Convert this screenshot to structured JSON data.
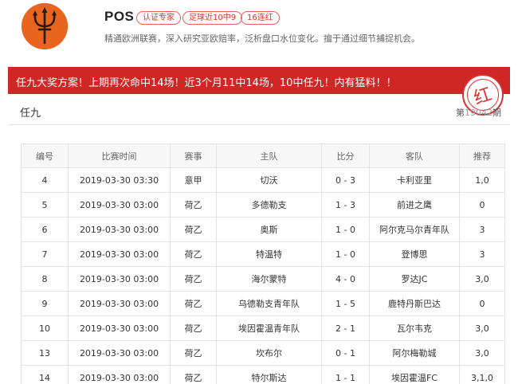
{
  "profile": {
    "avatar": "red-devil-trident-logo",
    "name": "POS",
    "badges": [
      "认证专家",
      "足球近10中9",
      "16连红"
    ],
    "bio": "精通欧洲联赛，深入研究亚欧赔率，泛析盘口水位变化。擅于通过细节捕捉机会。"
  },
  "banner": {
    "text": "任九大奖方案！上期再次命中14场！近3个月11中14场，10中任九！内有猛料！！",
    "stamp": "红",
    "color": "#cf2726"
  },
  "section": {
    "title": "任九",
    "period_prefix": "第",
    "period_number": "19042",
    "period_suffix": "期"
  },
  "table": {
    "headers": [
      "编号",
      "比赛时间",
      "赛事",
      "主队",
      "比分",
      "客队",
      "推荐"
    ],
    "rows": [
      [
        "4",
        "2019-03-30 03:30",
        "意甲",
        "切沃",
        "0 - 3",
        "卡利亚里",
        "1,0"
      ],
      [
        "5",
        "2019-03-30 03:00",
        "荷乙",
        "多德勒支",
        "1 - 3",
        "前进之鹰",
        "0"
      ],
      [
        "6",
        "2019-03-30 03:00",
        "荷乙",
        "奥斯",
        "1 - 0",
        "阿尔克马尔青年队",
        "3"
      ],
      [
        "7",
        "2019-03-30 03:00",
        "荷乙",
        "特温特",
        "1 - 0",
        "登博思",
        "3"
      ],
      [
        "8",
        "2019-03-30 03:00",
        "荷乙",
        "海尔蒙特",
        "4 - 0",
        "罗达JC",
        "3,0"
      ],
      [
        "9",
        "2019-03-30 03:00",
        "荷乙",
        "乌德勒支青年队",
        "1 - 5",
        "鹿特丹斯巴达",
        "0"
      ],
      [
        "10",
        "2019-03-30 03:00",
        "荷乙",
        "埃因霍温青年队",
        "2 - 1",
        "瓦尔韦克",
        "3,0"
      ],
      [
        "13",
        "2019-03-30 03:00",
        "荷乙",
        "坎布尔",
        "0 - 1",
        "阿尔梅勒城",
        "3,0"
      ],
      [
        "14",
        "2019-03-30 03:00",
        "荷乙",
        "特尔斯达",
        "1 - 1",
        "埃因霍温FC",
        "3,1,0"
      ]
    ]
  }
}
